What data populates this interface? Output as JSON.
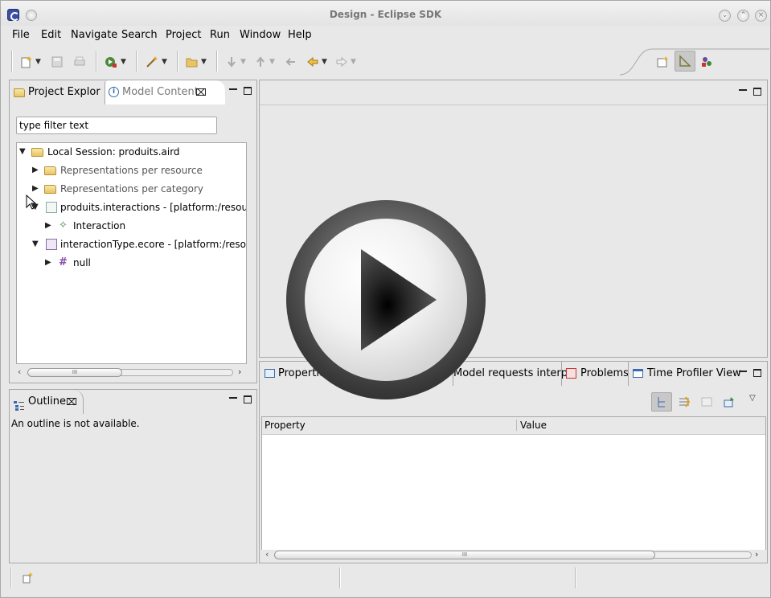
{
  "window": {
    "title": "Design - Eclipse SDK"
  },
  "menu": [
    "File",
    "Edit",
    "Navigate",
    "Search",
    "Project",
    "Run",
    "Window",
    "Help"
  ],
  "left_top": {
    "tabs": [
      "Project Explor",
      "Model Content"
    ],
    "filter_value": "type filter text",
    "tree": [
      {
        "label": "Local Session: produits.aird",
        "expanded": true
      },
      {
        "label": "Representations per resource"
      },
      {
        "label": "Representations per category"
      },
      {
        "label": "produits.interactions - [platform:/resourc",
        "expanded": true
      },
      {
        "label": "Interaction"
      },
      {
        "label": "interactionType.ecore - [platform:/resour",
        "expanded": true
      },
      {
        "label": "null"
      }
    ],
    "scroll_thumb": "III"
  },
  "outline": {
    "tab": "Outline",
    "message": "An outline is not available."
  },
  "bottom": {
    "tabs": [
      "Properties",
      "Model requests interpr",
      "Problems",
      "Time Profiler View"
    ],
    "columns": [
      "Property",
      "Value"
    ],
    "scroll_thumb": "III"
  },
  "colors": {
    "accent": "#3a4fa3",
    "play": "#1e1e1e"
  }
}
